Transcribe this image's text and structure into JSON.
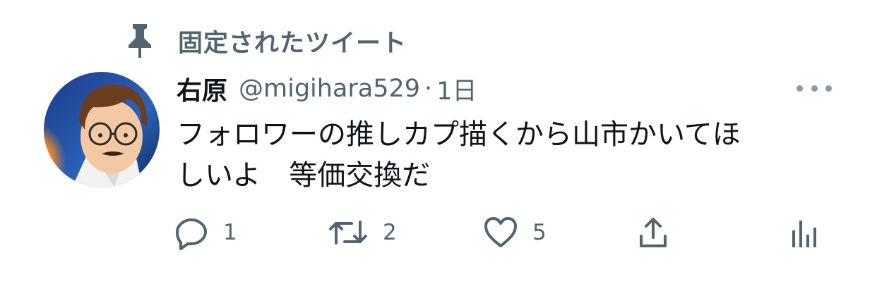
{
  "pinned": {
    "label": "固定されたツイート",
    "icon": "pin-icon"
  },
  "author": {
    "display_name": "右原",
    "handle": "@migihara529",
    "separator": "·",
    "time": "1日"
  },
  "tweet": {
    "text": "フォロワーの推しカプ描くから山市かいてほ\nしいよ　等価交換だ"
  },
  "actions": {
    "reply": {
      "icon": "reply-icon",
      "count": "1"
    },
    "retweet": {
      "icon": "retweet-icon",
      "count": "2"
    },
    "like": {
      "icon": "heart-icon",
      "count": "5"
    },
    "share": {
      "icon": "share-icon"
    },
    "analytics": {
      "icon": "analytics-icon"
    }
  },
  "colors": {
    "text": "#0f1419",
    "secondary": "#536471",
    "more_dots": "#8b98a5"
  }
}
